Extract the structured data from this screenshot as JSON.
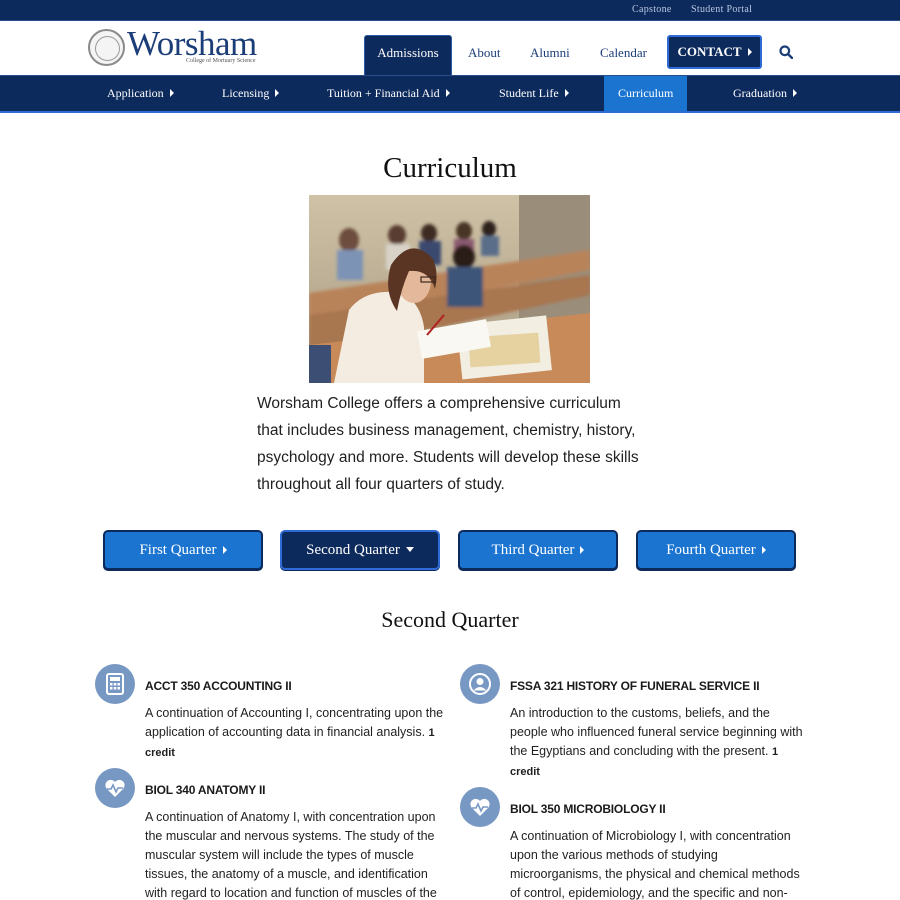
{
  "utility": {
    "links": [
      "Capstone",
      "Student Portal"
    ]
  },
  "header": {
    "logo_word": "Worsham",
    "logo_sub": "College of Mortuary Science",
    "nav": [
      "Admissions",
      "About",
      "Alumni",
      "Calendar",
      "CONTACT"
    ]
  },
  "subnav": [
    "Application",
    "Licensing",
    "Tuition + Financial Aid",
    "Student Life",
    "Curriculum",
    "Graduation"
  ],
  "page": {
    "title": "Curriculum",
    "intro": "Worsham College offers a comprehensive curriculum that includes business management, chemistry, history, psychology and more. Students will develop these skills throughout all four quarters of study."
  },
  "quarters": [
    "First Quarter",
    "Second Quarter",
    "Third Quarter",
    "Fourth Quarter"
  ],
  "section_title": "Second Quarter",
  "courses": [
    {
      "icon": "calculator-icon",
      "title": "ACCT 350 ACCOUNTING II",
      "desc": "A continuation of Accounting I, concentrating upon the application of accounting data in financial analysis.",
      "credit": "1 credit"
    },
    {
      "icon": "person-icon",
      "title": "FSSA 321 HISTORY OF FUNERAL SERVICE II",
      "desc": "An introduction to the customs, beliefs, and the people who influenced funeral service beginning with the Egyptians and concluding with the present.",
      "credit": "1 credit"
    },
    {
      "icon": "heart-pulse-icon",
      "title": "BIOL 340 ANATOMY II",
      "desc": "A continuation of Anatomy I, with concentration upon the muscular and nervous systems. The study of the muscular system will include the types of muscle tissues, the anatomy of a muscle, and identification with regard to location and function of muscles of the human body.",
      "credit": ""
    },
    {
      "icon": "heart-pulse-icon",
      "title": "BIOL 350 MICROBIOLOGY II",
      "desc": "A continuation of Microbiology I, with concentration upon the various methods of studying microorganisms, the physical and chemical methods of control, epidemiology, and the specific and non-specific defense mechanisms of",
      "credit": ""
    }
  ],
  "colors": {
    "navy": "#0d2a5c",
    "accent_blue": "#1a74d0",
    "icon_blue": "#7898c4"
  }
}
